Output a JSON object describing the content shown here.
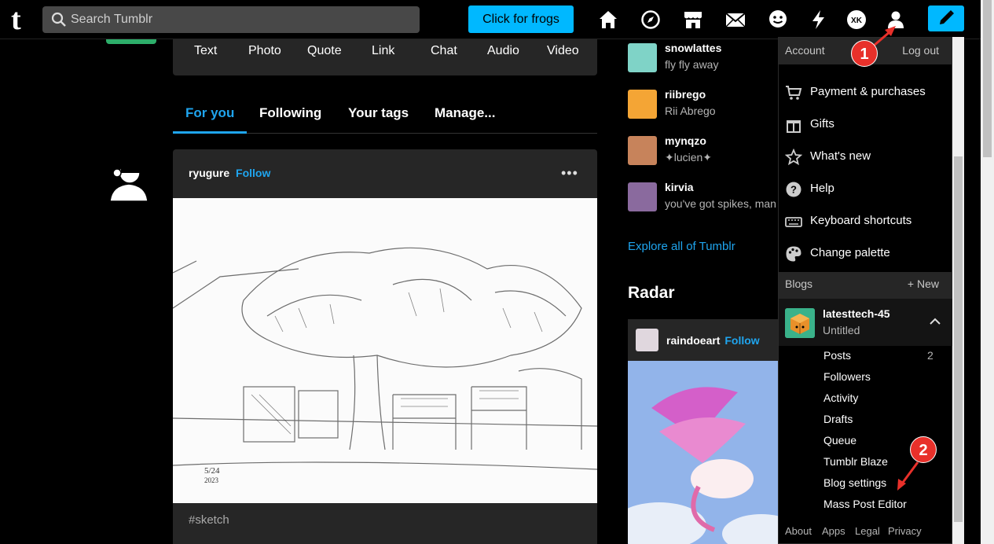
{
  "header": {
    "logo": "t",
    "search_placeholder": "Search Tumblr",
    "frogs_button": "Click for frogs",
    "nav_icons": [
      "home-icon",
      "explore-icon",
      "shop-icon",
      "inbox-icon",
      "messages-icon",
      "activity-icon",
      "xkit-icon",
      "account-icon",
      "compose-icon"
    ]
  },
  "post_types": [
    "Text",
    "Photo",
    "Quote",
    "Link",
    "Chat",
    "Audio",
    "Video"
  ],
  "tabs": [
    "For you",
    "Following",
    "Your tags",
    "Manage..."
  ],
  "post": {
    "author": "ryugure",
    "follow_label": "Follow",
    "menu": "•••",
    "tag": "#sketch"
  },
  "recommended": [
    {
      "name": "snowlattes",
      "subtitle": "fly fly away"
    },
    {
      "name": "riibrego",
      "subtitle": "Rii Abrego"
    },
    {
      "name": "mynqzo",
      "subtitle": "✦lucien✦"
    },
    {
      "name": "kirvia",
      "subtitle": "you've got spikes, man"
    }
  ],
  "explore_link": "Explore all of Tumblr",
  "radar": {
    "title": "Radar",
    "author": "raindoeart",
    "follow_label": "Follow"
  },
  "account_menu": {
    "header": "Account",
    "logout": "Log out",
    "items": [
      {
        "icon": "cart-icon",
        "label": "Payment & purchases"
      },
      {
        "icon": "gift-icon",
        "label": "Gifts"
      },
      {
        "icon": "star-icon",
        "label": "What's new"
      },
      {
        "icon": "help-icon",
        "label": "Help"
      },
      {
        "icon": "keyboard-icon",
        "label": "Keyboard shortcuts"
      },
      {
        "icon": "palette-icon",
        "label": "Change palette"
      }
    ],
    "blogs_header": "Blogs",
    "new_blog": "+ New",
    "blog": {
      "name": "latesttech-45",
      "title": "Untitled",
      "items": [
        {
          "label": "Posts",
          "count": "2"
        },
        {
          "label": "Followers",
          "count": ""
        },
        {
          "label": "Activity",
          "count": ""
        },
        {
          "label": "Drafts",
          "count": ""
        },
        {
          "label": "Queue",
          "count": ""
        },
        {
          "label": "Tumblr Blaze",
          "count": ""
        },
        {
          "label": "Blog settings",
          "count": ""
        },
        {
          "label": "Mass Post Editor",
          "count": ""
        }
      ]
    },
    "footer": [
      "About",
      "Apps",
      "Legal",
      "Privacy"
    ]
  },
  "callouts": [
    "1",
    "2"
  ],
  "colors": {
    "accent": "#00b8ff",
    "link": "#1fa5ef",
    "callout": "#e8302a",
    "card": "#262626"
  }
}
